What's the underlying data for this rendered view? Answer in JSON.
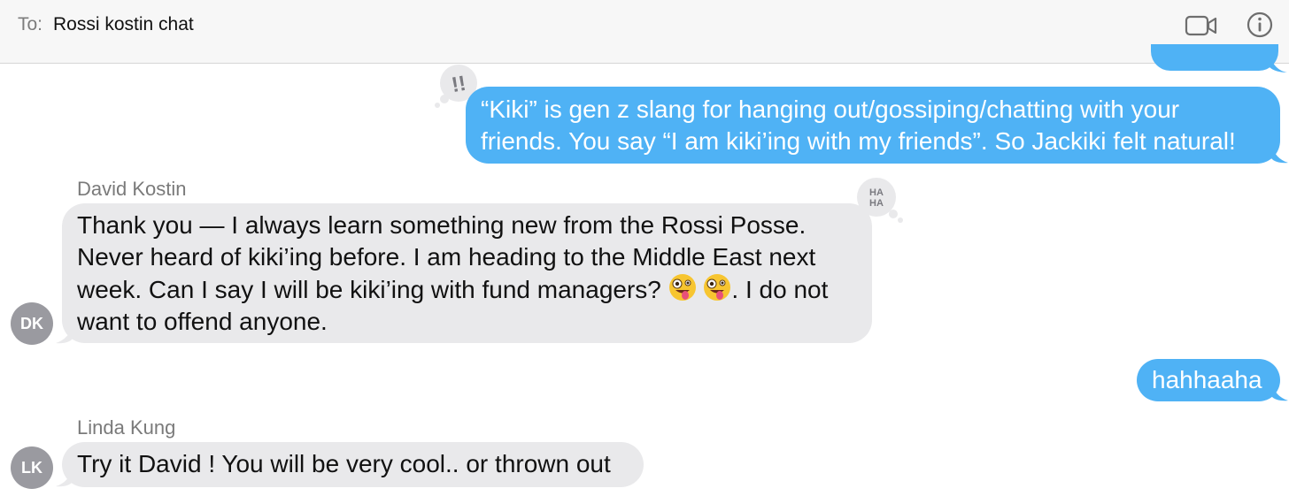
{
  "header": {
    "to_label": "To:",
    "recipient": "Rossi kostin chat",
    "video_icon": "video-camera-icon",
    "info_icon": "info-icon"
  },
  "colors": {
    "outgoing_bubble": "#4fb2f5",
    "incoming_bubble": "#e9e9eb",
    "avatar": "#9a9aa0"
  },
  "messages": [
    {
      "direction": "outgoing",
      "lines": [
        "“Kiki” is gen z slang for hanging out/gossiping/chatting with your",
        "friends. You say “I am kiki’ing with my friends”. So Jackiki felt natural!"
      ],
      "tapback": "exclamation-icon"
    },
    {
      "direction": "incoming",
      "sender": "David Kostin",
      "avatar_initials": "DK",
      "lines": [
        "Thank you — I always learn something new from the Rossi Posse.",
        "Never heard of kiki’ing  before. I am heading to the Middle East next",
        "week. Can I say I will be kiki’ing with fund managers?",
        ". I do not",
        "want to offend anyone."
      ],
      "emojis": [
        "zany-face-emoji",
        "zany-face-emoji"
      ],
      "tapback": "haha-icon",
      "tapback_text": [
        "HA",
        "HA"
      ]
    },
    {
      "direction": "outgoing",
      "lines": [
        "hahhaaha"
      ]
    },
    {
      "direction": "incoming",
      "sender": "Linda Kung",
      "avatar_initials": "LK",
      "lines": [
        "Try it David ! You will be very cool.. or thrown out"
      ]
    }
  ]
}
